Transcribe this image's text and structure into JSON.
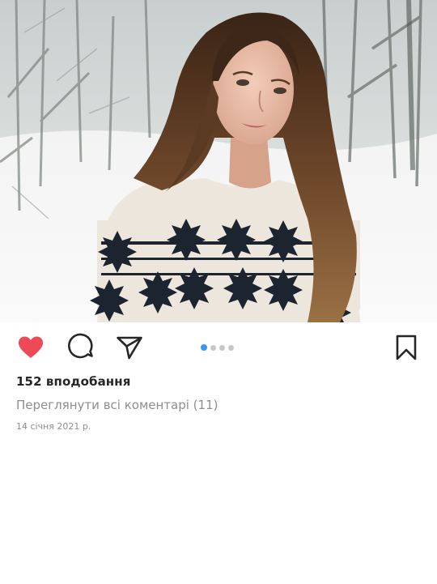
{
  "post": {
    "photo": {
      "subject": "portrait-photo"
    },
    "carousel": {
      "total": 4,
      "active_index": 0
    },
    "likes_text": "152 вподобання",
    "comments_link": "Переглянути всі коментарі (11)",
    "date": "14 січня 2021 р."
  },
  "icons": {
    "like": "heart-icon",
    "comment": "comment-icon",
    "share": "send-icon",
    "save": "bookmark-icon"
  },
  "colors": {
    "like_red": "#ed4956",
    "dot_active": "#3897f0",
    "dot_inactive": "#c7c7c7",
    "secondary_text": "#8e8e8e"
  }
}
